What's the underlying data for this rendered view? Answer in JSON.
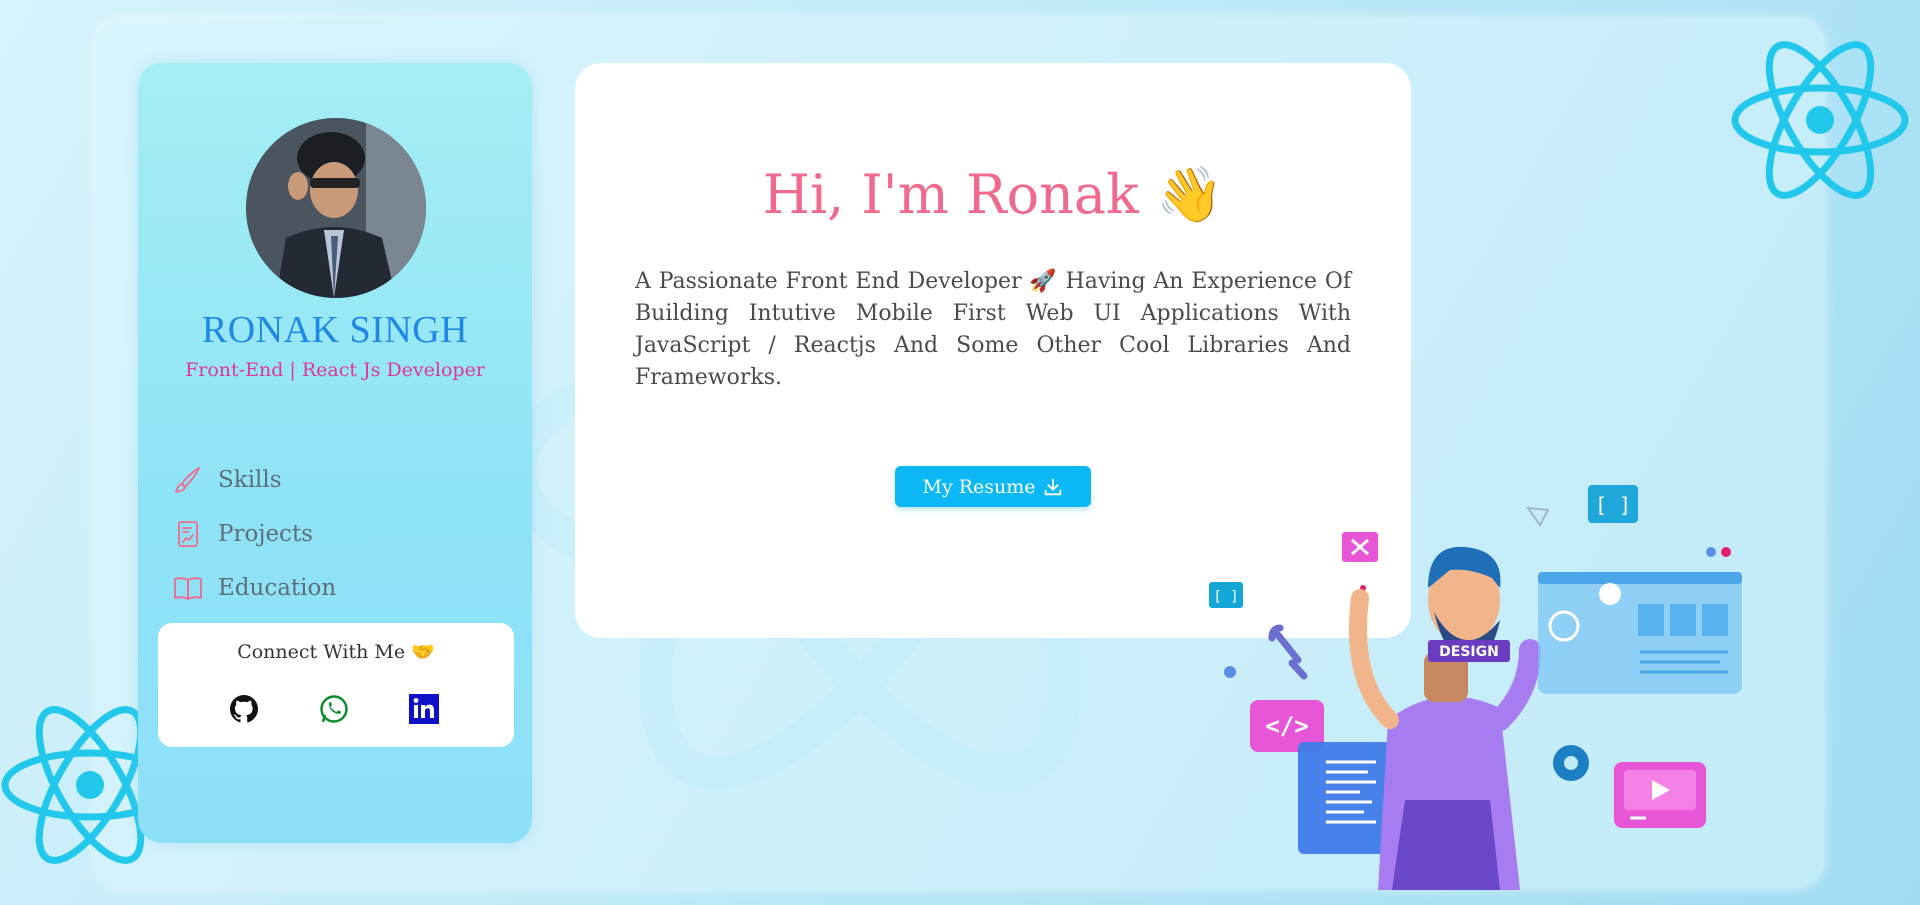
{
  "profile": {
    "name": "RONAK SINGH",
    "role": "Front-End | React Js Developer"
  },
  "nav": {
    "items": [
      {
        "label": "Skills",
        "icon": "brush-icon"
      },
      {
        "label": "Projects",
        "icon": "document-icon"
      },
      {
        "label": "Education",
        "icon": "book-icon"
      }
    ]
  },
  "connect": {
    "title": "Connect With Me 🤝",
    "links": [
      {
        "icon": "github-icon"
      },
      {
        "icon": "whatsapp-icon"
      },
      {
        "icon": "linkedin-icon"
      }
    ]
  },
  "hero": {
    "greeting": "Hi, I'm Ronak 👋",
    "bio": "A Passionate Front End Developer 🚀 Having An Experience Of Building Intutive Mobile First Web UI Applications With JavaScript / Reactjs And Some Other Cool Libraries And Frameworks.",
    "resume_label": "My Resume"
  },
  "illustration": {
    "shirt_text": "DESIGN"
  },
  "colors": {
    "accent": "#0bb7f5",
    "name": "#1e88e5",
    "role": "#e0359a",
    "greeting": "#f06a8d",
    "nav_icon": "#f06a8d"
  }
}
